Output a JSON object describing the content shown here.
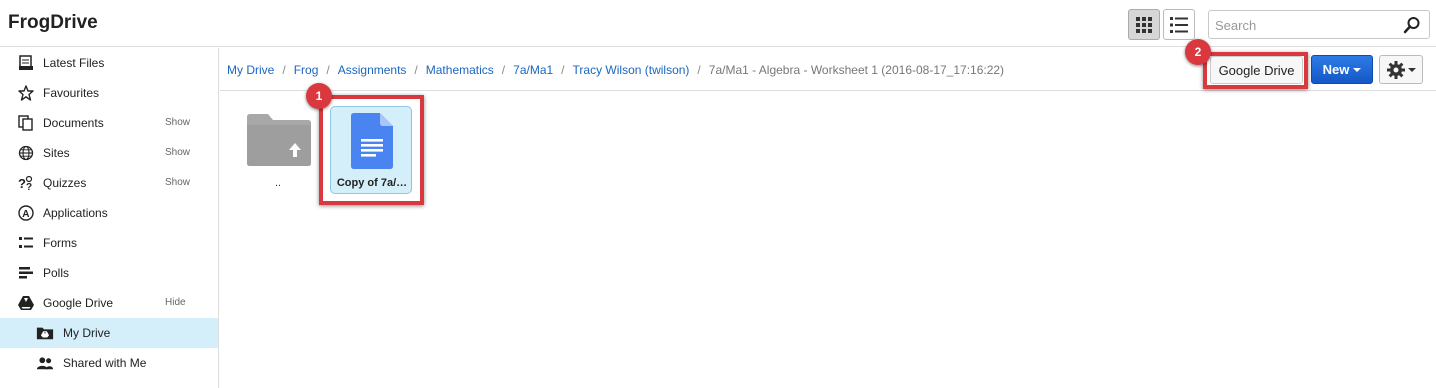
{
  "app": {
    "title": "FrogDrive"
  },
  "toolbar": {
    "grid_view_icon": "grid-icon",
    "list_view_icon": "list-icon",
    "search_placeholder": "Search"
  },
  "sidebar": {
    "items": [
      {
        "label": "Latest Files",
        "icon": "file-stack-icon",
        "action": ""
      },
      {
        "label": "Favourites",
        "icon": "star-icon",
        "action": ""
      },
      {
        "label": "Documents",
        "icon": "documents-icon",
        "action": "Show"
      },
      {
        "label": "Sites",
        "icon": "globe-icon",
        "action": "Show"
      },
      {
        "label": "Quizzes",
        "icon": "quiz-icon",
        "action": "Show"
      },
      {
        "label": "Applications",
        "icon": "applications-icon",
        "action": ""
      },
      {
        "label": "Forms",
        "icon": "forms-icon",
        "action": ""
      },
      {
        "label": "Polls",
        "icon": "polls-icon",
        "action": ""
      },
      {
        "label": "Google Drive",
        "icon": "google-drive-icon",
        "action": "Hide"
      },
      {
        "label": "My Drive",
        "icon": "my-drive-icon",
        "action": ""
      },
      {
        "label": "Shared with Me",
        "icon": "shared-people-icon",
        "action": ""
      }
    ]
  },
  "breadcrumb": {
    "links": [
      "My Drive",
      "Frog",
      "Assignments",
      "Mathematics",
      "7a/Ma1",
      "Tracy Wilson (twilson)"
    ],
    "separator": "/",
    "current": "7a/Ma1 - Algebra - Worksheet 1 (2016-08-17_17:16:22)"
  },
  "actions": {
    "google_drive_label": "Google Drive",
    "new_label": "New"
  },
  "files": {
    "parent_label": "..",
    "items": [
      {
        "name": "Copy of 7a/…",
        "type": "google-doc"
      }
    ]
  },
  "annotations": {
    "step1": "1",
    "step2": "2"
  },
  "colors": {
    "accent": "#1a66c2",
    "highlight": "#d9383f",
    "selected_bg": "#d4eefa",
    "new_button": "#1f67d8"
  }
}
